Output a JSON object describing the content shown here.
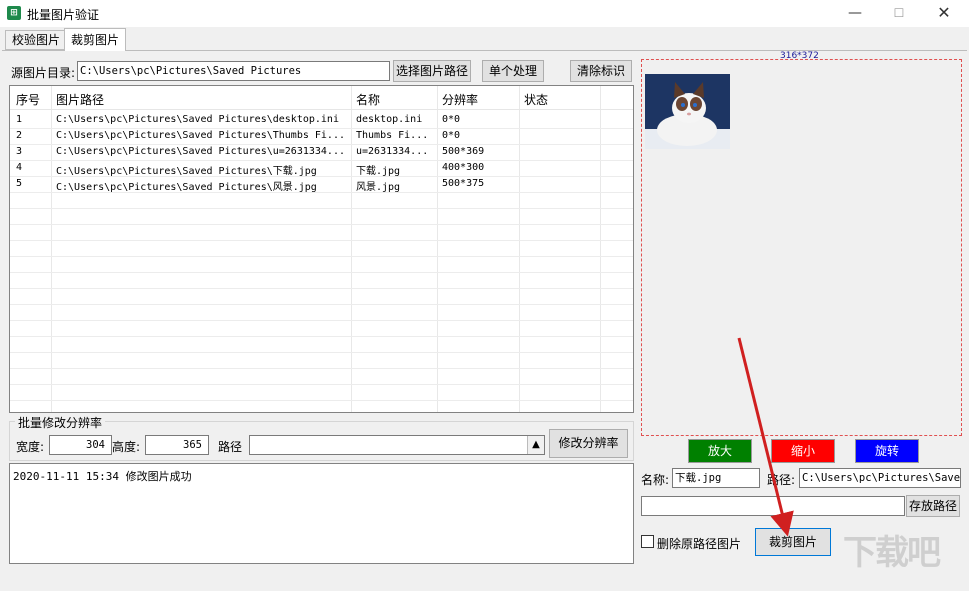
{
  "window": {
    "title": "批量图片验证",
    "minimize": "—",
    "maximize": "☐",
    "close": "✕"
  },
  "tabs": [
    {
      "label": "校验图片",
      "active": false
    },
    {
      "label": "裁剪图片",
      "active": true
    }
  ],
  "source": {
    "label": "源图片目录:",
    "value": "C:\\Users\\pc\\Pictures\\Saved Pictures",
    "select_button": "选择图片路径",
    "single_button": "单个处理",
    "clear_button": "清除标识"
  },
  "table": {
    "headers": [
      "序号",
      "图片路径",
      "名称",
      "分辨率",
      "状态"
    ],
    "rows": [
      {
        "no": "1",
        "path": "C:\\Users\\pc\\Pictures\\Saved Pictures\\desktop.ini",
        "name": "desktop.ini",
        "res": "0*0",
        "status": ""
      },
      {
        "no": "2",
        "path": "C:\\Users\\pc\\Pictures\\Saved Pictures\\Thumbs Fi...",
        "name": "Thumbs Fi...",
        "res": "0*0",
        "status": ""
      },
      {
        "no": "3",
        "path": "C:\\Users\\pc\\Pictures\\Saved Pictures\\u=2631334...",
        "name": "u=2631334...",
        "res": "500*369",
        "status": ""
      },
      {
        "no": "4",
        "path": "C:\\Users\\pc\\Pictures\\Saved Pictures\\下载.jpg",
        "name": "下载.jpg",
        "res": "400*300",
        "status": ""
      },
      {
        "no": "5",
        "path": "C:\\Users\\pc\\Pictures\\Saved Pictures\\风景.jpg",
        "name": "风景.jpg",
        "res": "500*375",
        "status": ""
      }
    ]
  },
  "batch": {
    "group_title": "批量修改分辨率",
    "width_label": "宽度:",
    "width_value": "304",
    "height_label": "高度:",
    "height_value": "365",
    "path_label": "路径",
    "path_value": "",
    "dropdown_icon": "▲",
    "modify_button": "修改分辨率"
  },
  "log": {
    "lines": [
      "2020-11-11 15:34 修改图片成功"
    ]
  },
  "preview": {
    "size_text": "316*372",
    "zoom_in": "放大",
    "zoom_out": "缩小",
    "rotate": "旋转",
    "colors": {
      "zoom_in": "#008000",
      "zoom_out": "#ff0000",
      "rotate": "#0000ff"
    }
  },
  "output": {
    "name_label": "名称:",
    "name_value": "下载.jpg",
    "path_label": "路径:",
    "path_value": "C:\\Users\\pc\\Pictures\\Saved",
    "save_path_value": "",
    "save_path_button": "存放路径",
    "delete_label": "删除原路径图片",
    "crop_button": "裁剪图片"
  },
  "watermark": "下载吧"
}
